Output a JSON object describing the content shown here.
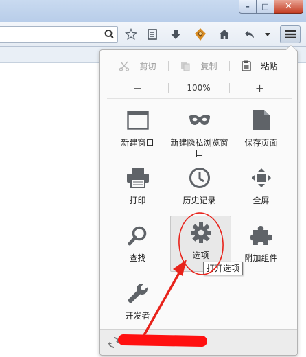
{
  "window": {
    "min": "–",
    "max": "□",
    "close": "✕"
  },
  "toolbar": {
    "url_value": "",
    "url_placeholder": "",
    "icons": [
      "search-icon",
      "bookmark-star-icon",
      "reading-list-icon",
      "download-icon",
      "addon-icon",
      "home-icon",
      "back-icon",
      "dropdown-icon",
      "hamburger-menu-icon"
    ]
  },
  "edit": {
    "cut": "剪切",
    "copy": "复制",
    "paste": "粘贴"
  },
  "zoom": {
    "minus": "−",
    "value": "100%",
    "plus": "+"
  },
  "tiles": [
    {
      "label": "新建窗口",
      "icon": "new-window-icon"
    },
    {
      "label": "新建隐私浏览窗口",
      "icon": "private-mask-icon"
    },
    {
      "label": "保存页面",
      "icon": "save-page-icon"
    },
    {
      "label": "打印",
      "icon": "printer-icon"
    },
    {
      "label": "历史记录",
      "icon": "clock-icon"
    },
    {
      "label": "全屏",
      "icon": "fullscreen-icon"
    },
    {
      "label": "查找",
      "icon": "magnifier-icon"
    },
    {
      "label": "选项",
      "icon": "gear-icon"
    },
    {
      "label": "附加组件",
      "icon": "puzzle-icon"
    },
    {
      "label": "开发者",
      "icon": "wrench-icon"
    }
  ],
  "tooltip": "打开选项",
  "colors": {
    "annotation_red": "#e8231b",
    "icon_gray": "#6a6e73"
  }
}
